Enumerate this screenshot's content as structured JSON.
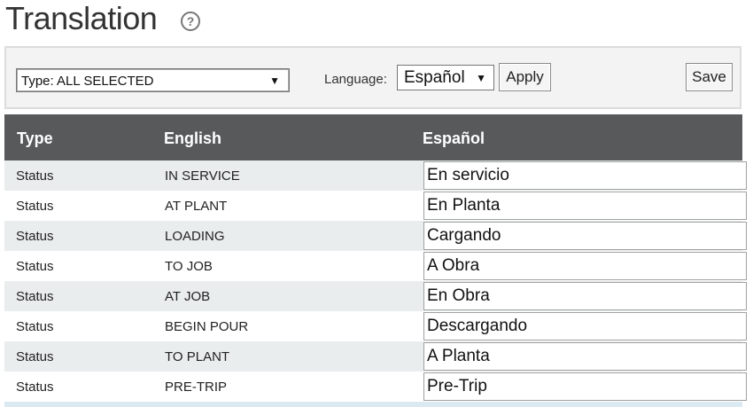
{
  "page": {
    "title": "Translation",
    "help_icon": "help-circle-icon"
  },
  "toolbar": {
    "type_select_value": "Type: ALL SELECTED",
    "language_label": "Language:",
    "language_value": "Español",
    "apply_label": "Apply",
    "save_label": "Save",
    "dropdown_glyph": "▼"
  },
  "table": {
    "headers": [
      "Type",
      "English",
      "Español"
    ],
    "rows": [
      {
        "type": "Status",
        "english": "IN SERVICE",
        "translation": "En servicio"
      },
      {
        "type": "Status",
        "english": "AT PLANT",
        "translation": "En Planta"
      },
      {
        "type": "Status",
        "english": "LOADING",
        "translation": "Cargando"
      },
      {
        "type": "Status",
        "english": "TO JOB",
        "translation": "A Obra"
      },
      {
        "type": "Status",
        "english": "AT JOB",
        "translation": "En Obra"
      },
      {
        "type": "Status",
        "english": "BEGIN POUR",
        "translation": "Descargando"
      },
      {
        "type": "Status",
        "english": "TO PLANT",
        "translation": "A Planta"
      },
      {
        "type": "Status",
        "english": "PRE-TRIP",
        "translation": "Pre-Trip"
      }
    ]
  },
  "colors": {
    "header_bg": "#58595b",
    "row_alt_bg": "#e9edee",
    "toolbar_bg": "#f3f3f3"
  }
}
